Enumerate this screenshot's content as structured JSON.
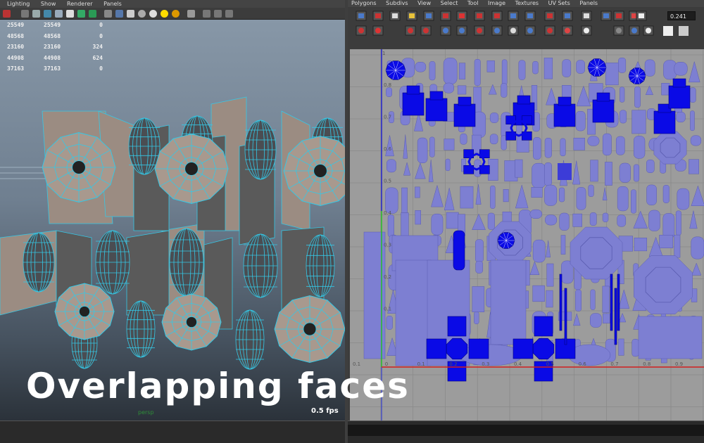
{
  "left_panel": {
    "menu": [
      "Lighting",
      "Show",
      "Renderer",
      "Panels"
    ],
    "stats": [
      [
        "25549",
        "25549",
        "0"
      ],
      [
        "48568",
        "48568",
        "0"
      ],
      [
        "23160",
        "23160",
        "324"
      ],
      [
        "44908",
        "44908",
        "624"
      ],
      [
        "37163",
        "37163",
        "0"
      ]
    ],
    "camera_label": "persp",
    "fps": "0.5 fps"
  },
  "right_panel": {
    "menu": [
      "Polygons",
      "Subdivs",
      "View",
      "Select",
      "Tool",
      "Image",
      "Textures",
      "UV Sets",
      "Panels"
    ],
    "uv_value": "0.241",
    "axis_top": "1",
    "axis_labels_bottom": [
      "0.1",
      "0",
      "0.1",
      "0.2",
      "0.3",
      "0.4",
      "0.5",
      "0.6",
      "0.7",
      "0.8",
      "0.9",
      "1"
    ],
    "axis_labels_left": [
      "0.8",
      "0.7",
      "0.6",
      "0.5",
      "0.4",
      "0.3",
      "0.2",
      "0.1"
    ]
  },
  "overlay": {
    "title": "Overlapping faces"
  },
  "colors": {
    "uv_shell": "#7d7fd2",
    "uv_overlap": "#0a0ae6",
    "wire": "#35c8e6",
    "uv_bg": "#9c9c9c",
    "grid": "#8a8a8a"
  }
}
